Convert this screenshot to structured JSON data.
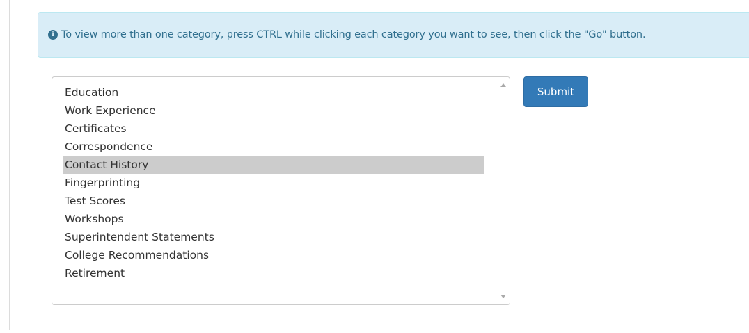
{
  "alert": {
    "icon": "info-circle-icon",
    "text": "To view more than one category, press CTRL while clicking each category you want to see, then click the \"Go\" button."
  },
  "category_list": {
    "selected": "Contact History",
    "options": [
      "Education",
      "Work Experience",
      "Certificates",
      "Correspondence",
      "Contact History",
      "Fingerprinting",
      "Test Scores",
      "Workshops",
      "Superintendent Statements",
      "College Recommendations",
      "Retirement"
    ]
  },
  "submit": {
    "label": "Submit",
    "color": "#337ab7"
  },
  "colors": {
    "alert_bg": "#d9edf7",
    "alert_text": "#31708f",
    "selected_bg": "#cccccc"
  }
}
